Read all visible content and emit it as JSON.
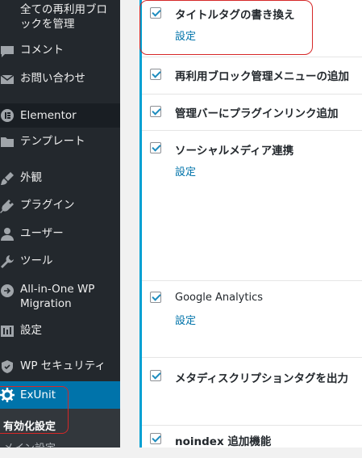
{
  "sidebar": {
    "items": [
      {
        "label_line1": "全ての再利用ブロ",
        "label_line2": "ックを管理"
      },
      {
        "label": "コメント",
        "icon": "comment-icon"
      },
      {
        "label": "お問い合わせ",
        "icon": "mail-icon"
      },
      {
        "label": "Elementor",
        "icon": "elementor-icon"
      },
      {
        "label": "テンプレート",
        "icon": "folder-icon"
      },
      {
        "label": "外観",
        "icon": "paintbrush-icon"
      },
      {
        "label": "プラグイン",
        "icon": "plugin-icon"
      },
      {
        "label": "ユーザー",
        "icon": "user-icon"
      },
      {
        "label": "ツール",
        "icon": "wrench-icon"
      },
      {
        "label_line1": "All-in-One WP",
        "label_line2": "Migration",
        "icon": "migration-icon"
      },
      {
        "label": "設定",
        "icon": "settings-icon"
      },
      {
        "label": "WP セキュリティ",
        "icon": "shield-icon"
      },
      {
        "label": "ExUnit",
        "icon": "gear-icon"
      }
    ],
    "submenu": [
      {
        "label": "有効化設定"
      },
      {
        "label": "メイン設定"
      }
    ]
  },
  "modules": [
    {
      "title": "タイトルタグの書き換え",
      "link": "設定",
      "checked": true
    },
    {
      "title": "再利用ブロック管理メニューの追加",
      "checked": true
    },
    {
      "title": "管理バーにプラグインリンク追加",
      "checked": true
    },
    {
      "title": "ソーシャルメディア連携",
      "link": "設定",
      "checked": true
    },
    {
      "title": "Google Analytics",
      "link": "設定",
      "checked": true
    },
    {
      "title": "メタディスクリプションタグを出力",
      "checked": true
    },
    {
      "title": "noindex 追加機能",
      "checked": true
    }
  ],
  "colors": {
    "highlight": "#d62828",
    "accent": "#0073aa",
    "sidebar_bg": "#23282d"
  }
}
